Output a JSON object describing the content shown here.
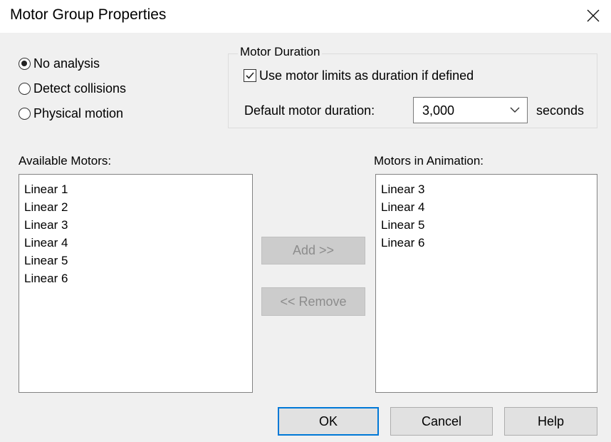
{
  "window": {
    "title": "Motor Group Properties"
  },
  "analysis": {
    "options": [
      {
        "label": "No analysis",
        "checked": true
      },
      {
        "label": "Detect collisions",
        "checked": false
      },
      {
        "label": "Physical motion",
        "checked": false
      }
    ]
  },
  "motor_duration": {
    "legend": "Motor Duration",
    "use_limits_label": "Use motor limits as duration if defined",
    "use_limits_checked": true,
    "default_label": "Default motor duration:",
    "default_value": "3,000",
    "units": "seconds"
  },
  "available": {
    "label": "Available Motors:",
    "items": [
      "Linear 1",
      "Linear 2",
      "Linear 3",
      "Linear 4",
      "Linear 5",
      "Linear 6"
    ]
  },
  "in_animation": {
    "label": "Motors in Animation:",
    "items": [
      "Linear 3",
      "Linear 4",
      "Linear 5",
      "Linear 6"
    ]
  },
  "buttons": {
    "add": "Add >>",
    "remove": "<< Remove",
    "ok": "OK",
    "cancel": "Cancel",
    "help": "Help"
  }
}
